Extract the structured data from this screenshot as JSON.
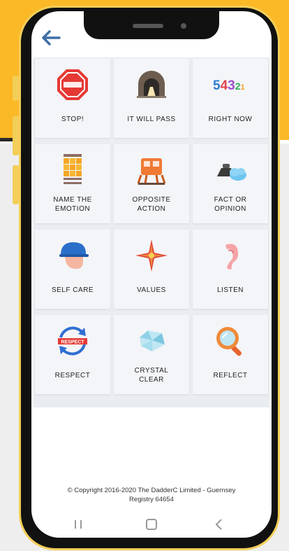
{
  "colors": {
    "brand_yellow": "#fbb928",
    "back_arrow": "#3f6fa8",
    "tile_bg": "#f4f5f8"
  },
  "header": {
    "back_icon": "back-arrow-icon"
  },
  "tiles": [
    {
      "label": "STOP!",
      "icon": "stop-sign-icon"
    },
    {
      "label": "IT WILL PASS",
      "icon": "tunnel-icon"
    },
    {
      "label": "RIGHT NOW",
      "icon": "countdown-numbers-icon",
      "number_text": "54321"
    },
    {
      "label": "NAME THE\nEMOTION",
      "icon": "emotion-grid-icon"
    },
    {
      "label": "OPPOSITE\nACTION",
      "icon": "opposite-action-icon"
    },
    {
      "label": "FACT OR\nOPINION",
      "icon": "fact-opinion-icon"
    },
    {
      "label": "SELF CARE",
      "icon": "self-care-helmet-icon"
    },
    {
      "label": "VALUES",
      "icon": "compass-rose-icon"
    },
    {
      "label": "LISTEN",
      "icon": "ear-icon"
    },
    {
      "label": "RESPECT",
      "icon": "respect-arrows-icon",
      "badge_text": "RESPECT"
    },
    {
      "label": "CRYSTAL\nCLEAR",
      "icon": "crystal-icon"
    },
    {
      "label": "REFLECT",
      "icon": "hand-mirror-icon"
    }
  ],
  "footer": {
    "copyright": "© Copyright 2016-2020 The DadderC Limited - Guernsey\nRegistry 64654"
  },
  "nav_bar": {
    "recents": "recents-icon",
    "home": "home-icon",
    "back": "nav-back-icon"
  }
}
